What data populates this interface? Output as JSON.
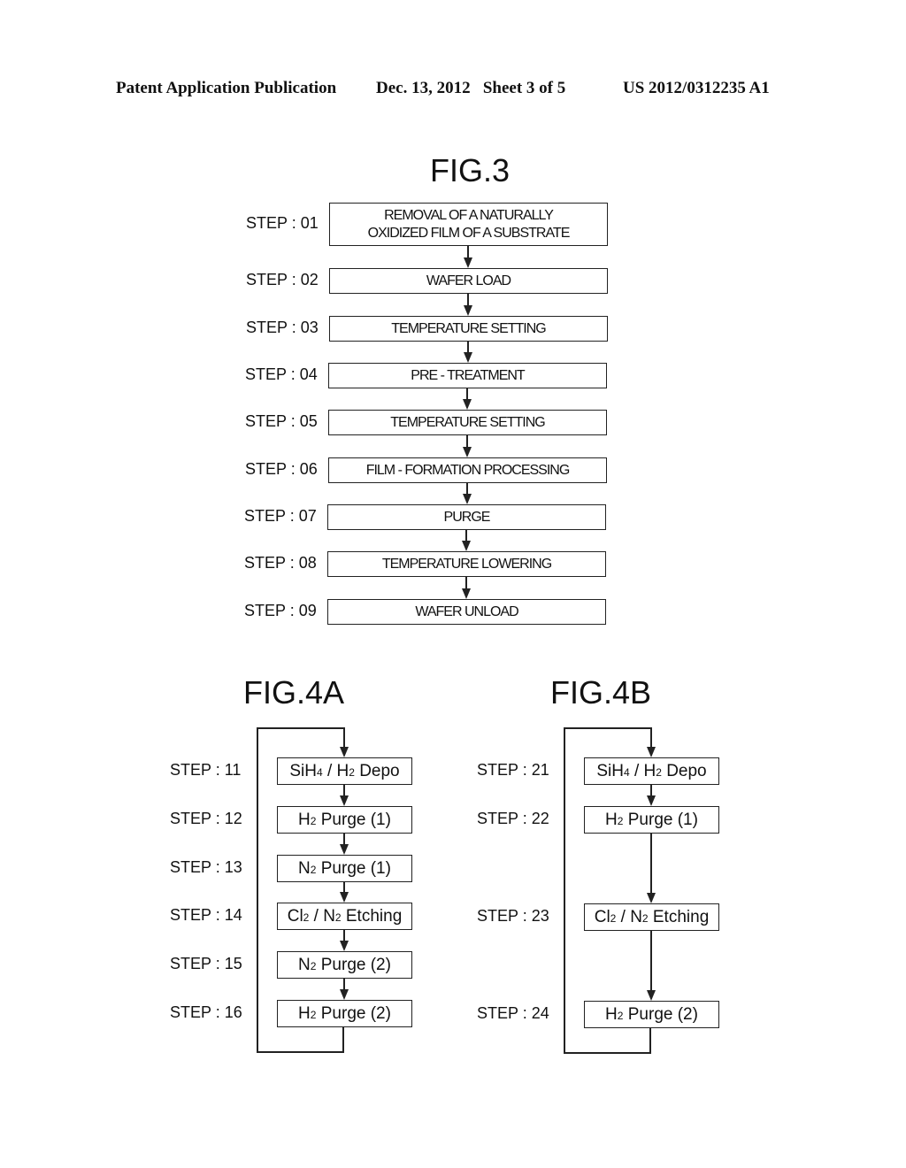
{
  "header": {
    "publication": "Patent Application Publication",
    "date_sheet": "Dec. 13, 2012   Sheet 3 of 5",
    "number": "US 2012/0312235 A1"
  },
  "fig3": {
    "title": "FIG.3",
    "steps": [
      {
        "label": "STEP : 01",
        "text_line1": "REMOVAL OF A NATURALLY",
        "text_line2": "OXIDIZED FILM OF A SUBSTRATE"
      },
      {
        "label": "STEP : 02",
        "text": "WAFER LOAD"
      },
      {
        "label": "STEP : 03",
        "text": "TEMPERATURE SETTING"
      },
      {
        "label": "STEP : 04",
        "text": "PRE - TREATMENT"
      },
      {
        "label": "STEP : 05",
        "text": "TEMPERATURE SETTING"
      },
      {
        "label": "STEP : 06",
        "text": "FILM - FORMATION PROCESSING"
      },
      {
        "label": "STEP : 07",
        "text": "PURGE"
      },
      {
        "label": "STEP : 08",
        "text": "TEMPERATURE LOWERING"
      },
      {
        "label": "STEP : 09",
        "text": "WAFER UNLOAD"
      }
    ]
  },
  "fig4a": {
    "title": "FIG.4A",
    "steps": [
      {
        "label": "STEP : 11",
        "text": "SiH4 / H2 Depo"
      },
      {
        "label": "STEP : 12",
        "text": "H2 Purge (1)"
      },
      {
        "label": "STEP : 13",
        "text": "N2 Purge (1)"
      },
      {
        "label": "STEP : 14",
        "text": "Cl2 / N2 Etching"
      },
      {
        "label": "STEP : 15",
        "text": "N2 Purge (2)"
      },
      {
        "label": "STEP : 16",
        "text": "H2 Purge (2)"
      }
    ]
  },
  "fig4b": {
    "title": "FIG.4B",
    "steps": [
      {
        "label": "STEP : 21",
        "text": "SiH4 / H2 Depo"
      },
      {
        "label": "STEP : 22",
        "text": "H2 Purge (1)"
      },
      {
        "label": "STEP : 23",
        "text": "Cl2 / N2 Etching"
      },
      {
        "label": "STEP : 24",
        "text": "H2 Purge (2)"
      }
    ]
  }
}
